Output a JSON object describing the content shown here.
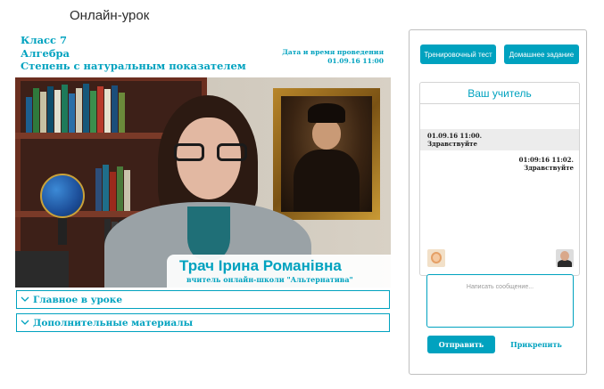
{
  "page": {
    "title": "Онлайн-урок"
  },
  "lesson": {
    "grade": "Класс 7",
    "subject": "Алгебра",
    "topic": "Степень с натуральным показателем",
    "date_label": "Дата и время проведения",
    "date_value": "01.09.16 11:00"
  },
  "video": {
    "teacher_name": "Трач Ірина Романівна",
    "teacher_role": "вчитель онлайн-школи \"Альтернатива\""
  },
  "accordions": [
    {
      "label": "Главное в уроке",
      "icon": "chevron-down-icon"
    },
    {
      "label": "Дополнительные материалы",
      "icon": "chevron-down-icon"
    }
  ],
  "panel": {
    "training_test_label": "Тренировочный тест",
    "homework_label": "Домашнее задание",
    "chat_title": "Ваш учитель",
    "messages": [
      {
        "time": "01.09.16 11:00.",
        "text": "Здравствуйте",
        "side": "left"
      },
      {
        "time": "01:09:16 11:02.",
        "text": "Здравствуйте",
        "side": "right"
      }
    ],
    "message_placeholder": "Написать сообщение...",
    "send_label": "Отправить",
    "attach_label": "Прикрепить"
  },
  "colors": {
    "accent": "#00a2bf",
    "message_bg": "#ececec"
  }
}
